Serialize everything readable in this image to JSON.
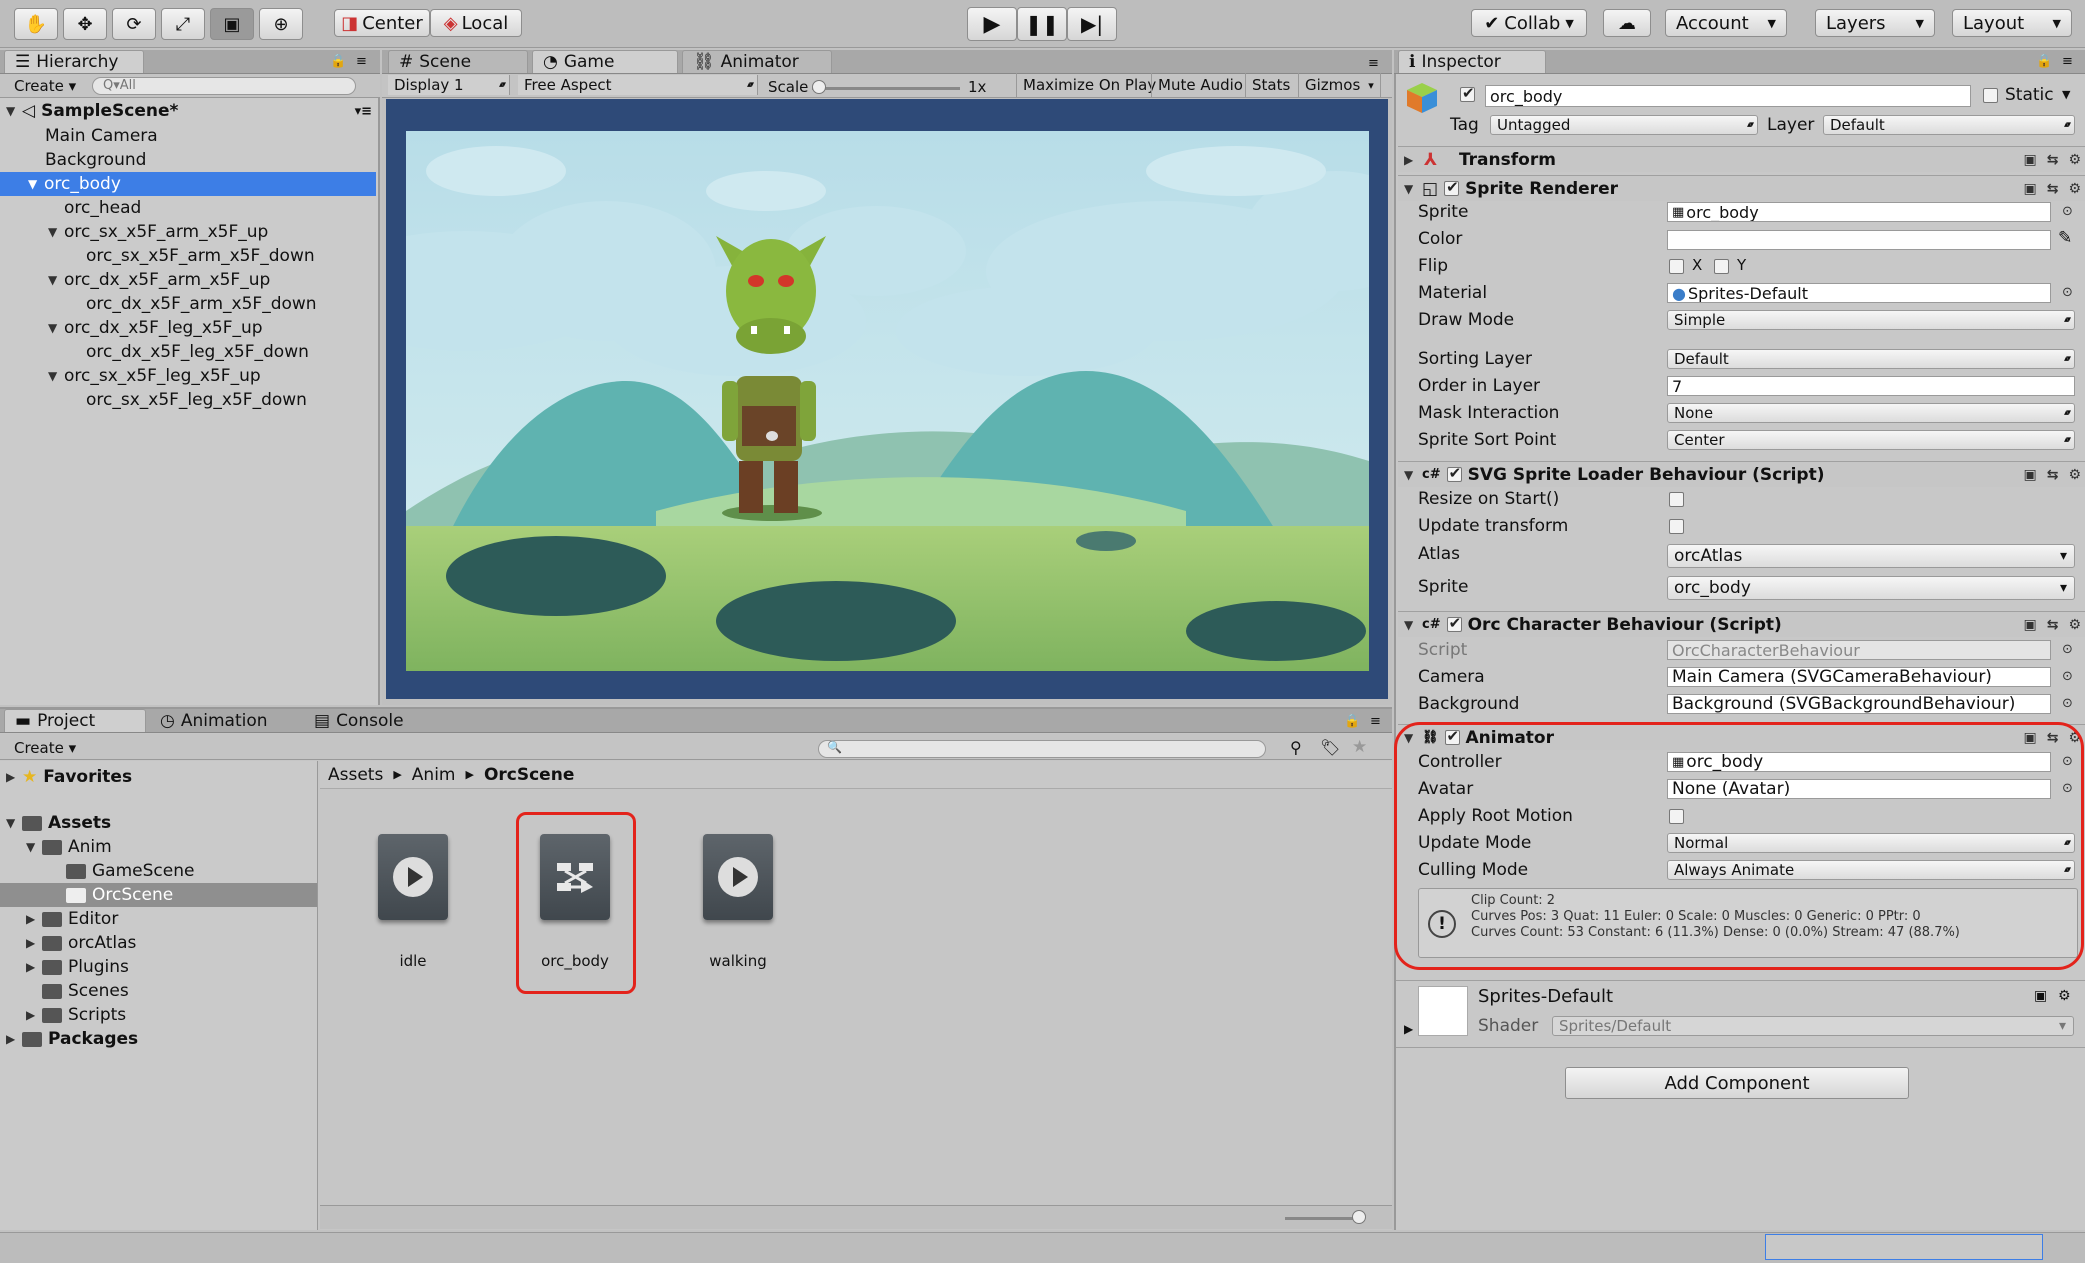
{
  "toolbar": {
    "tools": [
      "hand-tool-icon",
      "move-tool-icon",
      "rotate-tool-icon",
      "scale-tool-icon",
      "rect-tool-icon",
      "transform-tool-icon"
    ],
    "pivot": "Center",
    "space": "Local",
    "collab": "Collab",
    "account": "Account",
    "layers": "Layers",
    "layout": "Layout"
  },
  "hierarchy": {
    "tab": "Hierarchy",
    "create": "Create",
    "search_placeholder": "Q▾All",
    "scene": "SampleScene*",
    "items": [
      "Main Camera",
      "Background",
      "orc_body",
      "orc_head",
      "orc_sx_x5F_arm_x5F_up",
      "orc_sx_x5F_arm_x5F_down",
      "orc_dx_x5F_arm_x5F_up",
      "orc_dx_x5F_arm_x5F_down",
      "orc_dx_x5F_leg_x5F_up",
      "orc_dx_x5F_leg_x5F_down",
      "orc_sx_x5F_leg_x5F_up",
      "orc_sx_x5F_leg_x5F_down"
    ]
  },
  "view": {
    "tabs": [
      "Scene",
      "Game",
      "Animator"
    ],
    "display": "Display 1",
    "aspect": "Free Aspect",
    "scale_label": "Scale",
    "scale_value": "1x",
    "buttons": [
      "Maximize On Play",
      "Mute Audio",
      "Stats",
      "Gizmos"
    ]
  },
  "project": {
    "tabs": [
      "Project",
      "Animation",
      "Console"
    ],
    "create": "Create",
    "favorites": "Favorites",
    "assets": "Assets",
    "anim": "Anim",
    "tree": [
      "GameScene",
      "OrcScene",
      "Editor",
      "orcAtlas",
      "Plugins",
      "Scenes",
      "Scripts"
    ],
    "packages": "Packages",
    "breadcrumb": [
      "Assets",
      "Anim",
      "OrcScene"
    ],
    "files": [
      "idle",
      "orc_body",
      "walking"
    ]
  },
  "inspector": {
    "tab": "Inspector",
    "name": "orc_body",
    "static": "Static",
    "tag_label": "Tag",
    "tag": "Untagged",
    "layer_label": "Layer",
    "layer": "Default",
    "transform": "Transform",
    "sprite_renderer": {
      "title": "Sprite Renderer",
      "labels": [
        "Sprite",
        "Color",
        "Flip",
        "Material",
        "Draw Mode",
        "Sorting Layer",
        "Order in Layer",
        "Mask Interaction",
        "Sprite Sort Point"
      ],
      "sprite": "orc_body",
      "flip_x": "X",
      "flip_y": "Y",
      "material": "Sprites-Default",
      "draw_mode": "Simple",
      "sorting_layer": "Default",
      "order": "7",
      "mask": "None",
      "sort_point": "Center"
    },
    "svg_loader": {
      "title": "SVG Sprite Loader Behaviour (Script)",
      "labels": [
        "Resize on Start()",
        "Update transform",
        "Atlas",
        "Sprite"
      ],
      "atlas": "orcAtlas",
      "sprite": "orc_body"
    },
    "orc": {
      "title": "Orc Character Behaviour (Script)",
      "labels": [
        "Script",
        "Camera",
        "Background"
      ],
      "script": "OrcCharacterBehaviour",
      "camera": "Main Camera (SVGCameraBehaviour)",
      "background": "Background (SVGBackgroundBehaviour)"
    },
    "animator": {
      "title": "Animator",
      "labels": [
        "Controller",
        "Avatar",
        "Apply Root Motion",
        "Update Mode",
        "Culling Mode"
      ],
      "controller": "orc_body",
      "avatar": "None (Avatar)",
      "update_mode": "Normal",
      "culling_mode": "Always Animate",
      "info": [
        "Clip Count: 2",
        "Curves Pos: 3 Quat: 11 Euler: 0 Scale: 0 Muscles: 0 Generic: 0 PPtr: 0",
        "Curves Count: 53 Constant: 6 (11.3%) Dense: 0 (0.0%) Stream: 47 (88.7%)"
      ]
    },
    "material": {
      "name": "Sprites-Default",
      "shader_label": "Shader",
      "shader": "Sprites/Default"
    },
    "add_component": "Add Component"
  },
  "colors": {
    "highlight": "#3d7ee6",
    "annotation": "#e3231b",
    "editor_bg": "#c2c2c2"
  }
}
